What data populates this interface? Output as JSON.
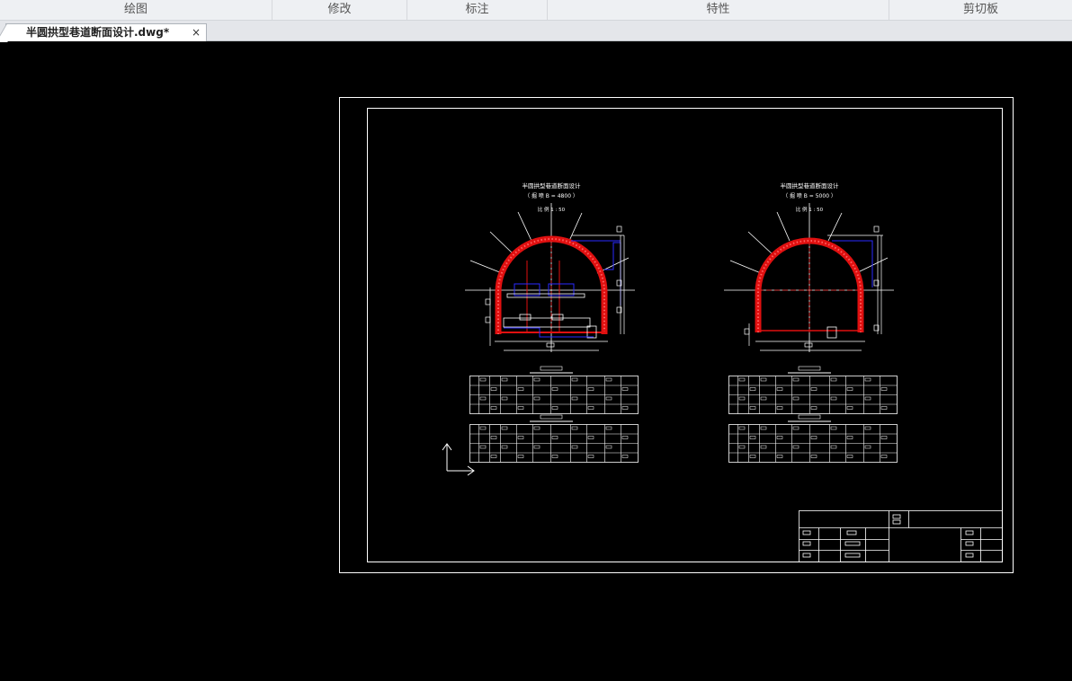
{
  "ribbon": {
    "tabs": [
      {
        "label": "绘图"
      },
      {
        "label": "修改"
      },
      {
        "label": "标注"
      },
      {
        "label": "特性"
      },
      {
        "label": "剪切板"
      }
    ]
  },
  "document_tab": {
    "title": "半圆拱型巷道断面设计.dwg*",
    "close_glyph": "×"
  },
  "drawing": {
    "left_section": {
      "title": "半圆拱型巷道断面设计",
      "subtitle": "（ 掘 喷   B = 4800 ）",
      "scale": "比 例  1 : 50"
    },
    "right_section": {
      "title": "半圆拱型巷道断面设计",
      "subtitle": "（ 掘 喷   B = 5000 ）",
      "scale": "比 例  1 : 50"
    }
  },
  "colors": {
    "ribbon_bg": "#eef0f3",
    "canvas_bg": "#000000",
    "line": "#ffffff",
    "arch": "#e01010",
    "pipe": "#2a2aff"
  }
}
